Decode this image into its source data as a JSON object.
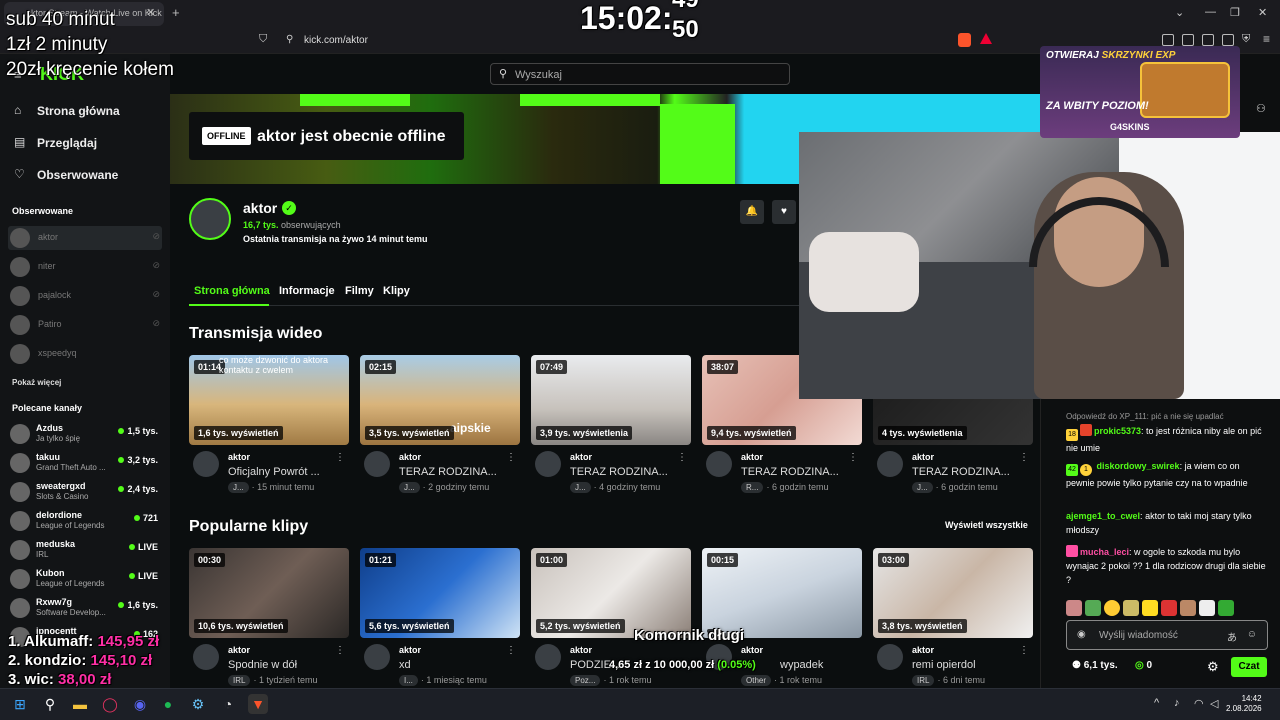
{
  "browser": {
    "tab_title": "aktor Stream - Watch Live on Kick",
    "url": "kick.com/aktor"
  },
  "nav": {
    "home": "Strona główna",
    "browse": "Przeglądaj",
    "following": "Obserwowane"
  },
  "sidebar": {
    "following_header": "Obserwowane",
    "following": [
      "aktor",
      "niter",
      "pajalock",
      "Patiro",
      "xspeedyq"
    ],
    "show_more": "Pokaż więcej",
    "recommended_header": "Polecane kanały",
    "recommended": [
      {
        "name": "Azdus",
        "sub": "Ja tylko śpię",
        "viewers": "1,5 tys."
      },
      {
        "name": "takuu",
        "sub": "Grand Theft Auto ...",
        "viewers": "3,2 tys."
      },
      {
        "name": "sweatergxd",
        "sub": "Slots & Casino",
        "viewers": "2,4 tys."
      },
      {
        "name": "delordione",
        "sub": "League of Legends",
        "viewers": "721"
      },
      {
        "name": "meduska",
        "sub": "IRL",
        "viewers": "LIVE"
      },
      {
        "name": "Kubon",
        "sub": "League of Legends",
        "viewers": "LIVE"
      },
      {
        "name": "Rxww7g",
        "sub": "Software Develop...",
        "viewers": "1,6 tys."
      },
      {
        "name": "jpnocentt",
        "sub": "",
        "viewers": "162"
      }
    ]
  },
  "search": {
    "placeholder": "Wyszukaj"
  },
  "banner": {
    "badge": "OFFLINE",
    "text": "aktor jest obecnie offline"
  },
  "channel": {
    "name": "aktor",
    "followers_count": "16,7 tys.",
    "followers_label": "obserwujących",
    "last_live": "Ostatnia transmisja na żywo 14 minut temu"
  },
  "tabs": [
    "Strona główna",
    "Informacje",
    "Filmy",
    "Klipy"
  ],
  "videos_header": "Transmisja wideo",
  "videos": [
    {
      "duration": "01:14",
      "views": "1,6 tys. wyświetleń",
      "channel": "aktor",
      "title": "Oficjalny Powrót ...",
      "tag": "J...",
      "ago": "15 minut temu",
      "overlay": "co może dzwonić do aktora kontaktu z cwelem"
    },
    {
      "duration": "02:15",
      "views": "3,5 tys. wyświetleń",
      "channel": "aktor",
      "title": "TERAZ RODZINA...",
      "tag": "J...",
      "ago": "2 godziny temu",
      "overlay": "aipskie"
    },
    {
      "duration": "07:49",
      "views": "3,9 tys. wyświetlenia",
      "channel": "aktor",
      "title": "TERAZ RODZINA...",
      "tag": "J...",
      "ago": "4 godziny temu",
      "overlay": ""
    },
    {
      "duration": "38:07",
      "views": "9,4 tys. wyświetleń",
      "channel": "aktor",
      "title": "TERAZ RODZINA...",
      "tag": "R...",
      "ago": "6 godzin temu",
      "overlay": ""
    },
    {
      "duration": "",
      "views": "4 tys. wyświetlenia",
      "channel": "aktor",
      "title": "TERAZ RODZINA...",
      "tag": "J...",
      "ago": "6 godzin temu",
      "overlay": ""
    }
  ],
  "clips_header": "Popularne klipy",
  "see_all": "Wyświetl wszystkie",
  "clips": [
    {
      "duration": "00:30",
      "views": "10,6 tys. wyświetleń",
      "channel": "aktor",
      "title": "Spodnie w dół",
      "tag": "IRL",
      "ago": "1 tydzień temu"
    },
    {
      "duration": "01:21",
      "views": "5,6 tys. wyświetleń",
      "channel": "aktor",
      "title": "xd",
      "tag": "I...",
      "ago": "1 miesiąc temu"
    },
    {
      "duration": "01:00",
      "views": "5,2 tys. wyświetleń",
      "channel": "aktor",
      "title": "PODZIE...",
      "tag": "Poz...",
      "ago": "1 rok temu"
    },
    {
      "duration": "00:15",
      "views": "",
      "channel": "aktor",
      "title": "wypadek",
      "tag": "Other",
      "ago": "1 rok temu"
    },
    {
      "duration": "03:00",
      "views": "3,8 tys. wyświetleń",
      "channel": "aktor",
      "title": "remi opierdol",
      "tag": "IRL",
      "ago": "6 dni temu"
    }
  ],
  "promo": {
    "line1a": "OTWIERAJ ",
    "line1b": "SKRZYNKI EXP",
    "line2": "ZA WBITY POZIOM!",
    "brand": "G4SKINS"
  },
  "chat": {
    "reply": "Odpowiedź do XP_111: pić a nie się upadlać",
    "messages": [
      {
        "badge": "18",
        "user": "prokic5373",
        "text": "to jest różnica niby ale on pić nie umie",
        "color": "#53fc18"
      },
      {
        "badge": "42",
        "user": "diskordowy_swirek",
        "text": "ja wiem co on pewnie powie tylko pytanie czy na to wpadnie",
        "color": "#53fc18"
      },
      {
        "badge": "",
        "user": "ajemge1_to_cwel",
        "text": "aktor to taki moj stary tylko młodszy",
        "color": "#53fc18"
      },
      {
        "badge": "",
        "user": "mucha_leci",
        "text": "w ogole to szkoda mu bylo wynajac 2 pokoi ?? 1 dla rodzicow drugi dla siebie ?",
        "color": "#ff4fa3"
      }
    ],
    "input_placeholder": "Wyślij wiadomość",
    "viewers": "6,1 tys.",
    "points": "0",
    "send": "Czat"
  },
  "overlay": {
    "top_lines": [
      "sub 40 minut",
      "1zł 2 minuty",
      "20zł kręcenie kołem"
    ],
    "timer": "15:02:",
    "timer_small_top": "49",
    "timer_small_bottom": "50",
    "ranking": [
      {
        "label": "1. Alkumaff:",
        "amount": "145,95 zł"
      },
      {
        "label": "2. kondzio:",
        "amount": "145,10 zł"
      },
      {
        "label": "3. wic:",
        "amount": "38,00 zł"
      }
    ],
    "goal_title": "Komornik długi",
    "goal_current": "4,65 zł",
    "goal_sep": "z",
    "goal_total": "10 000,00 zł",
    "goal_pct": "(0.05%)"
  },
  "taskbar": {
    "time": "14:42",
    "date": "2.08.2026"
  }
}
